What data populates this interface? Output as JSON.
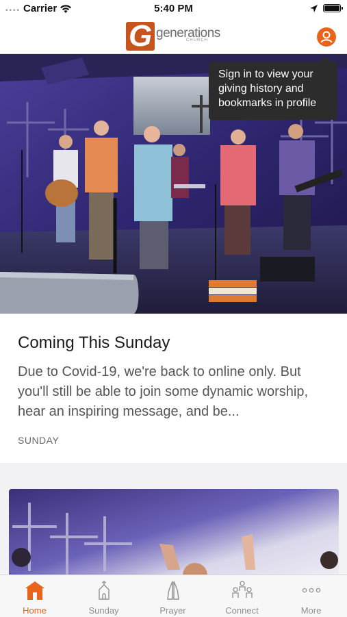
{
  "status_bar": {
    "carrier": "Carrier",
    "time": "5:40 PM"
  },
  "header": {
    "logo_text": "generations",
    "logo_subtext": "CHURCH",
    "profile_icon": "user-icon"
  },
  "tooltip": {
    "text": "Sign in to view your giving history and bookmarks in profile"
  },
  "feed": [
    {
      "title": "Coming This Sunday",
      "description": "Due to Covid-19, we're back to online only. But you'll still be able to join some dynamic worship, hear an inspiring message, and be...",
      "tag": "SUNDAY"
    }
  ],
  "tabs": [
    {
      "label": "Home",
      "icon": "church-icon",
      "active": true
    },
    {
      "label": "Sunday",
      "icon": "chapel-icon",
      "active": false
    },
    {
      "label": "Prayer",
      "icon": "praying-hands-icon",
      "active": false
    },
    {
      "label": "Connect",
      "icon": "people-icon",
      "active": false
    },
    {
      "label": "More",
      "icon": "ellipsis-icon",
      "active": false
    }
  ],
  "colors": {
    "accent": "#e8641a",
    "logo": "#c6541f",
    "tooltip_bg": "#2c2c2c"
  }
}
